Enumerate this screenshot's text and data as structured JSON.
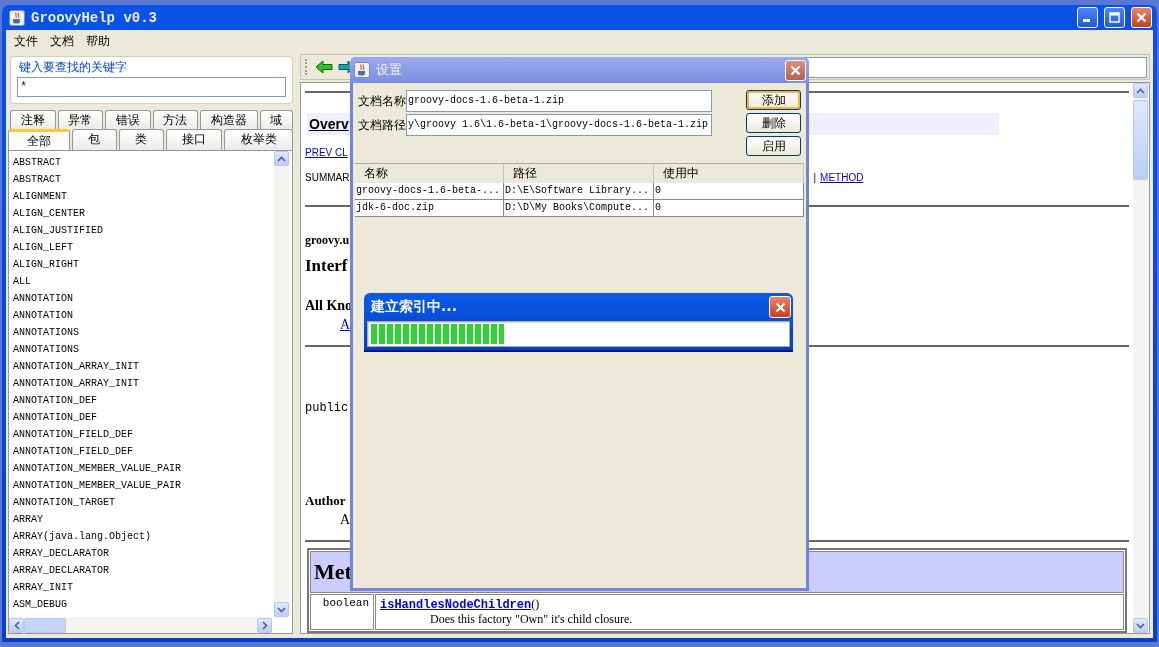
{
  "window": {
    "title": "GroovyHelp v0.3"
  },
  "menu": [
    "文件",
    "文档",
    "帮助"
  ],
  "search": {
    "legend": "键入要查找的关键字",
    "value": "*"
  },
  "tab_rows": [
    {
      "tabs": [
        {
          "label": "注释",
          "selected": false
        },
        {
          "label": "异常",
          "selected": false
        },
        {
          "label": "错误",
          "selected": false
        },
        {
          "label": "方法",
          "selected": false
        },
        {
          "label": "构造器",
          "selected": false
        },
        {
          "label": "域",
          "selected": false
        }
      ]
    },
    {
      "tabs": [
        {
          "label": "全部",
          "selected": true
        },
        {
          "label": "包",
          "selected": false
        },
        {
          "label": "类",
          "selected": false
        },
        {
          "label": "接口",
          "selected": false
        },
        {
          "label": "枚举类",
          "selected": false
        }
      ]
    }
  ],
  "list": {
    "items": [
      "ABSTRACT",
      "ABSTRACT",
      "ALIGNMENT",
      "ALIGN_CENTER",
      "ALIGN_JUSTIFIED",
      "ALIGN_LEFT",
      "ALIGN_RIGHT",
      "ALL",
      "ANNOTATION",
      "ANNOTATION",
      "ANNOTATIONS",
      "ANNOTATIONS",
      "ANNOTATION_ARRAY_INIT",
      "ANNOTATION_ARRAY_INIT",
      "ANNOTATION_DEF",
      "ANNOTATION_DEF",
      "ANNOTATION_FIELD_DEF",
      "ANNOTATION_FIELD_DEF",
      "ANNOTATION_MEMBER_VALUE_PAIR",
      "ANNOTATION_MEMBER_VALUE_PAIR",
      "ANNOTATION_TARGET",
      "ARRAY",
      "ARRAY(java.lang.Object)",
      "ARRAY_DECLARATOR",
      "ARRAY_DECLARATOR",
      "ARRAY_INIT",
      "ASM_DEBUG"
    ]
  },
  "doc": {
    "heading_tab": "Overv",
    "prev_link": "PREV CL",
    "summary": "SUMMAR",
    "separator": "|",
    "method_link": "METHOD",
    "package": "groovy.u",
    "title": "Interf",
    "known_label": "All Kno",
    "known_link": "A",
    "signature": "public",
    "author_label": "Author",
    "author_value": "A",
    "method_table": {
      "heading": "Met",
      "rows": [
        {
          "type": "boolean",
          "name": "isHandlesNodeChildren",
          "params": "()",
          "description": "Does this factory \"Own\" it's child closure."
        }
      ]
    }
  },
  "settings_dialog": {
    "title": "设置",
    "fields": [
      {
        "label": "文档名称",
        "value": "groovy-docs-1.6-beta-1.zip"
      },
      {
        "label": "文档路径",
        "value": "y\\groovy 1.6\\1.6-beta-1\\groovy-docs-1.6-beta-1.zip"
      }
    ],
    "buttons": [
      {
        "label": "添加",
        "focused": true
      },
      {
        "label": "删除",
        "focused": false
      },
      {
        "label": "启用",
        "focused": false
      }
    ],
    "table": {
      "columns": [
        "名称",
        "路径",
        "使用中"
      ],
      "rows": [
        [
          "groovy-docs-1.6-beta-...",
          "D:\\E\\Software Library...",
          "0"
        ],
        [
          "jdk-6-doc.zip",
          "D:\\D\\My Books\\Compute...",
          "0"
        ]
      ]
    }
  },
  "progress_dialog": {
    "title": "建立索引中...",
    "level": 0.32
  }
}
